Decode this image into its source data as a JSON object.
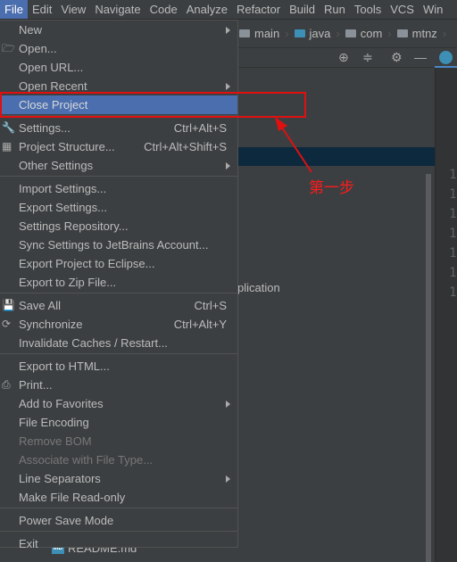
{
  "menubar": [
    "File",
    "Edit",
    "View",
    "Navigate",
    "Code",
    "Analyze",
    "Refactor",
    "Build",
    "Run",
    "Tools",
    "VCS",
    "Win"
  ],
  "breadcrumbs": [
    "main",
    "java",
    "com",
    "mtnz"
  ],
  "line_numbers": [
    "1",
    "2",
    "3",
    "8",
    "9",
    "10",
    "11",
    "12",
    "13",
    "14",
    "17",
    "18"
  ],
  "behind_text": "plication",
  "readme": "README.md",
  "readme_icon": "MD",
  "menu": [
    {
      "label": "New",
      "arrow": true
    },
    {
      "label": "Open...",
      "icon": "folder-open-icon"
    },
    {
      "label": "Open URL..."
    },
    {
      "label": "Open Recent",
      "arrow": true
    },
    {
      "label": "Close Project",
      "selected": true
    },
    {
      "sep": true
    },
    {
      "label": "Settings...",
      "shortcut": "Ctrl+Alt+S",
      "icon": "wrench-icon"
    },
    {
      "label": "Project Structure...",
      "shortcut": "Ctrl+Alt+Shift+S",
      "icon": "project-structure-icon"
    },
    {
      "label": "Other Settings",
      "arrow": true
    },
    {
      "sep": true
    },
    {
      "label": "Import Settings..."
    },
    {
      "label": "Export Settings..."
    },
    {
      "label": "Settings Repository..."
    },
    {
      "label": "Sync Settings to JetBrains Account..."
    },
    {
      "label": "Export Project to Eclipse..."
    },
    {
      "label": "Export to Zip File..."
    },
    {
      "sep": true
    },
    {
      "label": "Save All",
      "shortcut": "Ctrl+S",
      "icon": "save-icon"
    },
    {
      "label": "Synchronize",
      "shortcut": "Ctrl+Alt+Y",
      "icon": "sync-icon"
    },
    {
      "label": "Invalidate Caches / Restart..."
    },
    {
      "sep": true
    },
    {
      "label": "Export to HTML..."
    },
    {
      "label": "Print...",
      "icon": "print-icon"
    },
    {
      "label": "Add to Favorites",
      "arrow": true
    },
    {
      "label": "File Encoding"
    },
    {
      "label": "Remove BOM",
      "disabled": true
    },
    {
      "label": "Associate with File Type...",
      "disabled": true
    },
    {
      "label": "Line Separators",
      "arrow": true
    },
    {
      "label": "Make File Read-only"
    },
    {
      "sep": true
    },
    {
      "label": "Power Save Mode"
    },
    {
      "sep": true
    },
    {
      "label": "Exit"
    }
  ],
  "annotation": "第一步",
  "colors": {
    "selection": "#4b6eaf",
    "annotation": "#e01010",
    "background": "#3c3f41"
  }
}
